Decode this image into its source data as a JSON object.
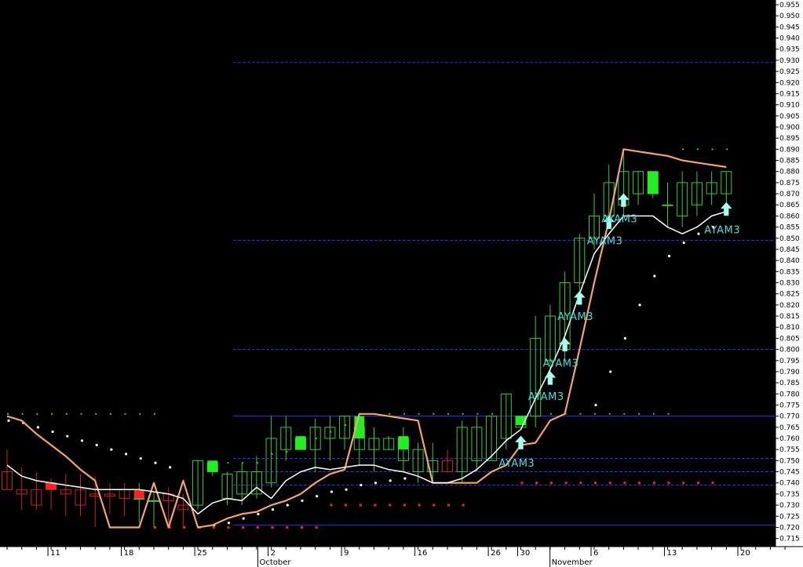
{
  "chart_data": {
    "type": "candlestick",
    "title": "",
    "xlabel": "",
    "ylabel": "",
    "ylim": [
      0.713,
      0.96
    ],
    "y_ticks": [
      "0.955",
      "0.950",
      "0.945",
      "0.940",
      "0.935",
      "0.930",
      "0.925",
      "0.920",
      "0.915",
      "0.910",
      "0.905",
      "0.900",
      "0.895",
      "0.890",
      "0.885",
      "0.880",
      "0.875",
      "0.870",
      "0.865",
      "0.860",
      "0.855",
      "0.850",
      "0.845",
      "0.840",
      "0.835",
      "0.830",
      "0.825",
      "0.820",
      "0.815",
      "0.810",
      "0.805",
      "0.800",
      "0.795",
      "0.790",
      "0.785",
      "0.780",
      "0.775",
      "0.770",
      "0.765",
      "0.760",
      "0.755",
      "0.750",
      "0.745",
      "0.740",
      "0.735",
      "0.730",
      "0.725",
      "0.720",
      "0.715"
    ],
    "x_day_labels": [
      {
        "i": 3,
        "label": "11"
      },
      {
        "i": 8,
        "label": "18"
      },
      {
        "i": 13,
        "label": "25"
      },
      {
        "i": 18,
        "label": "2"
      },
      {
        "i": 23,
        "label": "9"
      },
      {
        "i": 28,
        "label": "16"
      },
      {
        "i": 33,
        "label": "26"
      },
      {
        "i": 35,
        "label": "30"
      },
      {
        "i": 40,
        "label": "6"
      },
      {
        "i": 45,
        "label": "13"
      },
      {
        "i": 50,
        "label": "20"
      }
    ],
    "x_month_labels": [
      {
        "i": 17.3,
        "label": "October"
      },
      {
        "i": 37.2,
        "label": "November"
      }
    ],
    "h_levels": [
      0.929,
      0.849,
      0.8,
      0.77,
      0.751,
      0.745,
      0.739,
      0.721
    ],
    "h_levels_color": "#2233ee",
    "candles": [
      {
        "o": 0.745,
        "h": 0.755,
        "l": 0.737,
        "c": 0.737
      },
      {
        "o": 0.737,
        "h": 0.747,
        "l": 0.728,
        "c": 0.735
      },
      {
        "o": 0.737,
        "h": 0.745,
        "l": 0.728,
        "c": 0.73
      },
      {
        "o": 0.74,
        "h": 0.742,
        "l": 0.728,
        "c": 0.737
      },
      {
        "o": 0.737,
        "h": 0.744,
        "l": 0.725,
        "c": 0.735
      },
      {
        "o": 0.737,
        "h": 0.744,
        "l": 0.725,
        "c": 0.73
      },
      {
        "o": 0.735,
        "h": 0.743,
        "l": 0.72,
        "c": 0.734
      },
      {
        "o": 0.735,
        "h": 0.74,
        "l": 0.726,
        "c": 0.734
      },
      {
        "o": 0.737,
        "h": 0.74,
        "l": 0.725,
        "c": 0.733
      },
      {
        "o": 0.733,
        "h": 0.74,
        "l": 0.722,
        "c": 0.733
      },
      {
        "o": 0.732,
        "h": 0.736,
        "l": 0.72,
        "c": 0.732
      },
      {
        "o": 0.735,
        "h": 0.738,
        "l": 0.722,
        "c": 0.732
      },
      {
        "o": 0.73,
        "h": 0.735,
        "l": 0.72,
        "c": 0.728
      },
      {
        "o": 0.73,
        "h": 0.75,
        "l": 0.728,
        "c": 0.75
      },
      {
        "o": 0.745,
        "h": 0.75,
        "l": 0.743,
        "c": 0.749
      },
      {
        "o": 0.733,
        "h": 0.745,
        "l": 0.73,
        "c": 0.744
      },
      {
        "o": 0.735,
        "h": 0.749,
        "l": 0.73,
        "c": 0.745
      },
      {
        "o": 0.735,
        "h": 0.752,
        "l": 0.733,
        "c": 0.745
      },
      {
        "o": 0.74,
        "h": 0.77,
        "l": 0.738,
        "c": 0.76
      },
      {
        "o": 0.755,
        "h": 0.77,
        "l": 0.75,
        "c": 0.765
      },
      {
        "o": 0.755,
        "h": 0.761,
        "l": 0.755,
        "c": 0.76
      },
      {
        "o": 0.755,
        "h": 0.769,
        "l": 0.745,
        "c": 0.765
      },
      {
        "o": 0.76,
        "h": 0.77,
        "l": 0.75,
        "c": 0.765
      },
      {
        "o": 0.76,
        "h": 0.77,
        "l": 0.755,
        "c": 0.77
      },
      {
        "o": 0.755,
        "h": 0.77,
        "l": 0.748,
        "c": 0.765
      },
      {
        "o": 0.755,
        "h": 0.765,
        "l": 0.745,
        "c": 0.76
      },
      {
        "o": 0.755,
        "h": 0.761,
        "l": 0.755,
        "c": 0.76
      },
      {
        "o": 0.75,
        "h": 0.765,
        "l": 0.745,
        "c": 0.76
      },
      {
        "o": 0.745,
        "h": 0.758,
        "l": 0.74,
        "c": 0.755
      },
      {
        "o": 0.745,
        "h": 0.758,
        "l": 0.74,
        "c": 0.75
      },
      {
        "o": 0.75,
        "h": 0.755,
        "l": 0.745,
        "c": 0.745
      },
      {
        "o": 0.745,
        "h": 0.768,
        "l": 0.74,
        "c": 0.765
      },
      {
        "o": 0.75,
        "h": 0.77,
        "l": 0.745,
        "c": 0.765
      },
      {
        "o": 0.75,
        "h": 0.77,
        "l": 0.75,
        "c": 0.77
      },
      {
        "o": 0.76,
        "h": 0.78,
        "l": 0.755,
        "c": 0.78
      },
      {
        "o": 0.765,
        "h": 0.77,
        "l": 0.766,
        "c": 0.77
      },
      {
        "o": 0.77,
        "h": 0.815,
        "l": 0.765,
        "c": 0.805
      },
      {
        "o": 0.795,
        "h": 0.82,
        "l": 0.79,
        "c": 0.815
      },
      {
        "o": 0.8,
        "h": 0.835,
        "l": 0.795,
        "c": 0.83
      },
      {
        "o": 0.83,
        "h": 0.852,
        "l": 0.82,
        "c": 0.85
      },
      {
        "o": 0.85,
        "h": 0.87,
        "l": 0.845,
        "c": 0.86
      },
      {
        "o": 0.86,
        "h": 0.883,
        "l": 0.855,
        "c": 0.875
      },
      {
        "o": 0.865,
        "h": 0.89,
        "l": 0.86,
        "c": 0.88
      },
      {
        "o": 0.87,
        "h": 0.88,
        "l": 0.865,
        "c": 0.88
      },
      {
        "o": 0.87,
        "h": 0.88,
        "l": 0.868,
        "c": 0.88
      },
      {
        "o": 0.865,
        "h": 0.875,
        "l": 0.855,
        "c": 0.865
      },
      {
        "o": 0.86,
        "h": 0.88,
        "l": 0.855,
        "c": 0.875
      },
      {
        "o": 0.865,
        "h": 0.88,
        "l": 0.86,
        "c": 0.875
      },
      {
        "o": 0.87,
        "h": 0.88,
        "l": 0.865,
        "c": 0.875
      },
      {
        "o": 0.87,
        "h": 0.88,
        "l": 0.865,
        "c": 0.88
      }
    ],
    "colors": {
      "up": "#33cc33",
      "down": "#cc2222",
      "strong_up": "#22ee22",
      "strong_down": "#ff2222",
      "white_line": "#ffffff",
      "orange_line": "#f4a46a",
      "annotation": "#3fe0e0",
      "axis_bg": "#ffffff"
    },
    "strong_up_bars": [
      {
        "i": 14,
        "lo": 0.745,
        "hi": 0.75
      },
      {
        "i": 20,
        "lo": 0.755,
        "hi": 0.761
      },
      {
        "i": 24,
        "lo": 0.76,
        "hi": 0.77
      },
      {
        "i": 27,
        "lo": 0.755,
        "hi": 0.761
      },
      {
        "i": 35,
        "lo": 0.766,
        "hi": 0.77
      },
      {
        "i": 44,
        "lo": 0.87,
        "hi": 0.88
      }
    ],
    "strong_down_bars": [
      {
        "i": 3,
        "lo": 0.737,
        "hi": 0.74
      },
      {
        "i": 9,
        "lo": 0.733,
        "hi": 0.737
      }
    ],
    "white_line": [
      0.748,
      0.743,
      0.741,
      0.74,
      0.739,
      0.738,
      0.737,
      0.737,
      0.737,
      0.737,
      0.736,
      0.735,
      0.733,
      0.726,
      0.731,
      0.733,
      0.732,
      0.738,
      0.733,
      0.741,
      0.745,
      0.747,
      0.746,
      0.747,
      0.748,
      0.748,
      0.746,
      0.745,
      0.743,
      0.74,
      0.74,
      0.742,
      0.746,
      0.752,
      0.759,
      0.764,
      0.778,
      0.791,
      0.806,
      0.825,
      0.843,
      0.852,
      0.86,
      0.86,
      0.86,
      0.855,
      0.852,
      0.855,
      0.86,
      0.862
    ],
    "orange_line": [
      0.77,
      0.768,
      0.762,
      0.757,
      0.752,
      0.746,
      0.741,
      0.72,
      0.72,
      0.72,
      0.74,
      0.72,
      0.741,
      0.72,
      0.721,
      0.724,
      0.726,
      0.727,
      0.73,
      0.732,
      0.735,
      0.74,
      0.744,
      0.746,
      0.771,
      0.771,
      0.77,
      0.769,
      0.768,
      0.74,
      0.74,
      0.74,
      0.74,
      0.745,
      0.748,
      0.757,
      0.758,
      0.768,
      0.771,
      0.8,
      0.83,
      0.858,
      0.89,
      0.889,
      0.888,
      0.887,
      0.885,
      0.884,
      0.883,
      0.882
    ],
    "dots_white": [
      {
        "i": 0,
        "v": 0.768
      },
      {
        "i": 1,
        "v": 0.767
      },
      {
        "i": 2,
        "v": 0.765
      },
      {
        "i": 3,
        "v": 0.763
      },
      {
        "i": 4,
        "v": 0.761
      },
      {
        "i": 5,
        "v": 0.759
      },
      {
        "i": 6,
        "v": 0.757
      },
      {
        "i": 7,
        "v": 0.755
      },
      {
        "i": 8,
        "v": 0.753
      },
      {
        "i": 9,
        "v": 0.751
      },
      {
        "i": 10,
        "v": 0.749
      },
      {
        "i": 11,
        "v": 0.747
      },
      {
        "i": 13,
        "v": 0.72
      },
      {
        "i": 14,
        "v": 0.721
      },
      {
        "i": 15,
        "v": 0.722
      },
      {
        "i": 16,
        "v": 0.724
      },
      {
        "i": 17,
        "v": 0.726
      },
      {
        "i": 18,
        "v": 0.728
      },
      {
        "i": 19,
        "v": 0.73
      },
      {
        "i": 20,
        "v": 0.732
      },
      {
        "i": 21,
        "v": 0.734
      },
      {
        "i": 22,
        "v": 0.736
      },
      {
        "i": 23,
        "v": 0.737
      },
      {
        "i": 24,
        "v": 0.739
      },
      {
        "i": 25,
        "v": 0.74
      },
      {
        "i": 26,
        "v": 0.741
      },
      {
        "i": 27,
        "v": 0.742
      },
      {
        "i": 40,
        "v": 0.775
      },
      {
        "i": 41,
        "v": 0.79
      },
      {
        "i": 42,
        "v": 0.805
      },
      {
        "i": 43,
        "v": 0.82
      },
      {
        "i": 44,
        "v": 0.833
      },
      {
        "i": 45,
        "v": 0.842
      },
      {
        "i": 46,
        "v": 0.848
      },
      {
        "i": 47,
        "v": 0.852
      },
      {
        "i": 48,
        "v": 0.855
      }
    ],
    "dots_green": [
      {
        "i": 0,
        "v": 0.771
      },
      {
        "i": 1,
        "v": 0.771
      },
      {
        "i": 2,
        "v": 0.771
      },
      {
        "i": 3,
        "v": 0.771
      },
      {
        "i": 4,
        "v": 0.771
      },
      {
        "i": 5,
        "v": 0.771
      },
      {
        "i": 6,
        "v": 0.771
      },
      {
        "i": 7,
        "v": 0.771
      },
      {
        "i": 8,
        "v": 0.771
      },
      {
        "i": 9,
        "v": 0.771
      },
      {
        "i": 10,
        "v": 0.771
      },
      {
        "i": 15,
        "v": 0.749
      },
      {
        "i": 16,
        "v": 0.749
      },
      {
        "i": 17,
        "v": 0.749
      },
      {
        "i": 18,
        "v": 0.753
      },
      {
        "i": 19,
        "v": 0.754
      },
      {
        "i": 20,
        "v": 0.757
      },
      {
        "i": 21,
        "v": 0.76
      },
      {
        "i": 22,
        "v": 0.763
      },
      {
        "i": 23,
        "v": 0.766
      },
      {
        "i": 24,
        "v": 0.771
      },
      {
        "i": 25,
        "v": 0.771
      },
      {
        "i": 26,
        "v": 0.771
      },
      {
        "i": 27,
        "v": 0.771
      },
      {
        "i": 28,
        "v": 0.771
      },
      {
        "i": 29,
        "v": 0.771
      },
      {
        "i": 30,
        "v": 0.771
      },
      {
        "i": 31,
        "v": 0.771
      },
      {
        "i": 32,
        "v": 0.771
      },
      {
        "i": 33,
        "v": 0.771
      },
      {
        "i": 37,
        "v": 0.771
      },
      {
        "i": 38,
        "v": 0.771
      },
      {
        "i": 39,
        "v": 0.771
      },
      {
        "i": 40,
        "v": 0.771
      },
      {
        "i": 41,
        "v": 0.771
      },
      {
        "i": 42,
        "v": 0.771
      },
      {
        "i": 43,
        "v": 0.771
      },
      {
        "i": 44,
        "v": 0.771
      },
      {
        "i": 45,
        "v": 0.771
      },
      {
        "i": 46,
        "v": 0.89
      },
      {
        "i": 47,
        "v": 0.89
      },
      {
        "i": 48,
        "v": 0.89
      },
      {
        "i": 49,
        "v": 0.89
      }
    ],
    "dots_red": [
      {
        "i": 10,
        "v": 0.72
      },
      {
        "i": 11,
        "v": 0.72
      },
      {
        "i": 12,
        "v": 0.72
      },
      {
        "i": 13,
        "v": 0.72
      },
      {
        "i": 14,
        "v": 0.72
      },
      {
        "i": 15,
        "v": 0.72
      },
      {
        "i": 16,
        "v": 0.72
      },
      {
        "i": 17,
        "v": 0.72
      },
      {
        "i": 18,
        "v": 0.72
      },
      {
        "i": 19,
        "v": 0.72
      },
      {
        "i": 20,
        "v": 0.72
      },
      {
        "i": 21,
        "v": 0.72
      },
      {
        "i": 22,
        "v": 0.73
      },
      {
        "i": 23,
        "v": 0.73
      },
      {
        "i": 24,
        "v": 0.73
      },
      {
        "i": 25,
        "v": 0.73
      },
      {
        "i": 26,
        "v": 0.73
      },
      {
        "i": 27,
        "v": 0.73
      },
      {
        "i": 28,
        "v": 0.73
      },
      {
        "i": 29,
        "v": 0.73
      },
      {
        "i": 30,
        "v": 0.73
      },
      {
        "i": 31,
        "v": 0.73
      },
      {
        "i": 35,
        "v": 0.74
      },
      {
        "i": 36,
        "v": 0.74
      },
      {
        "i": 37,
        "v": 0.74
      },
      {
        "i": 38,
        "v": 0.74
      },
      {
        "i": 39,
        "v": 0.74
      },
      {
        "i": 40,
        "v": 0.74
      },
      {
        "i": 41,
        "v": 0.74
      },
      {
        "i": 42,
        "v": 0.74
      },
      {
        "i": 43,
        "v": 0.74
      },
      {
        "i": 44,
        "v": 0.74
      },
      {
        "i": 45,
        "v": 0.74
      },
      {
        "i": 46,
        "v": 0.74
      },
      {
        "i": 47,
        "v": 0.74
      },
      {
        "i": 48,
        "v": 0.74
      }
    ],
    "signals": [
      {
        "i": 35,
        "arrow_v": 0.758,
        "text_v": 0.749,
        "label": "AYAM3"
      },
      {
        "i": 37,
        "arrow_v": 0.787,
        "text_v": 0.779,
        "label": "AYAM3"
      },
      {
        "i": 38,
        "arrow_v": 0.802,
        "text_v": 0.794,
        "label": "AYAM3"
      },
      {
        "i": 39,
        "arrow_v": 0.823,
        "text_v": 0.815,
        "label": "AYAM3"
      },
      {
        "i": 41,
        "arrow_v": 0.857,
        "text_v": 0.849,
        "label": "AYAM3"
      },
      {
        "i": 42,
        "arrow_v": 0.867,
        "text_v": 0.859,
        "label": "AYAM3"
      },
      {
        "i": 49,
        "arrow_v": 0.863,
        "text_v": 0.854,
        "label": "AYAM3"
      }
    ]
  }
}
